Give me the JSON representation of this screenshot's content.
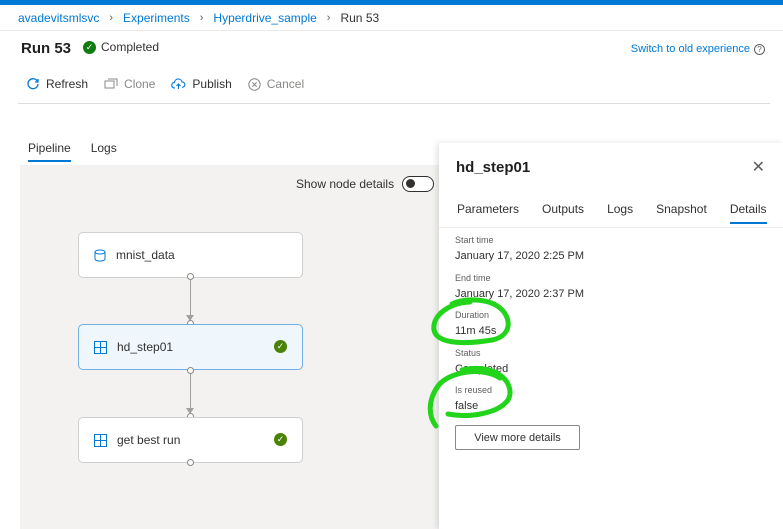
{
  "breadcrumb": [
    "avadevitsmlsvc",
    "Experiments",
    "Hyperdrive_sample",
    "Run 53"
  ],
  "run": {
    "title": "Run 53",
    "status": "Completed"
  },
  "switch_experience": "Switch to old experience",
  "toolbar": {
    "refresh": "Refresh",
    "clone": "Clone",
    "publish": "Publish",
    "cancel": "Cancel"
  },
  "tabs": [
    "Pipeline",
    "Logs"
  ],
  "canvas": {
    "show_node_details": "Show node details",
    "nodes": [
      "mnist_data",
      "hd_step01",
      "get best run"
    ]
  },
  "panel": {
    "title": "hd_step01",
    "tabs": [
      "Parameters",
      "Outputs",
      "Logs",
      "Snapshot",
      "Details"
    ],
    "fields": [
      {
        "label": "Start time",
        "value": "January 17, 2020 2:25 PM"
      },
      {
        "label": "End time",
        "value": "January 17, 2020 2:37 PM"
      },
      {
        "label": "Duration",
        "value": "11m 45s"
      },
      {
        "label": "Status",
        "value": "Completed"
      },
      {
        "label": "Is reused",
        "value": "false"
      }
    ],
    "view_more": "View more details"
  },
  "colors": {
    "accent": "#0078d4",
    "success": "#107c10",
    "annotation": "#22d41a"
  }
}
